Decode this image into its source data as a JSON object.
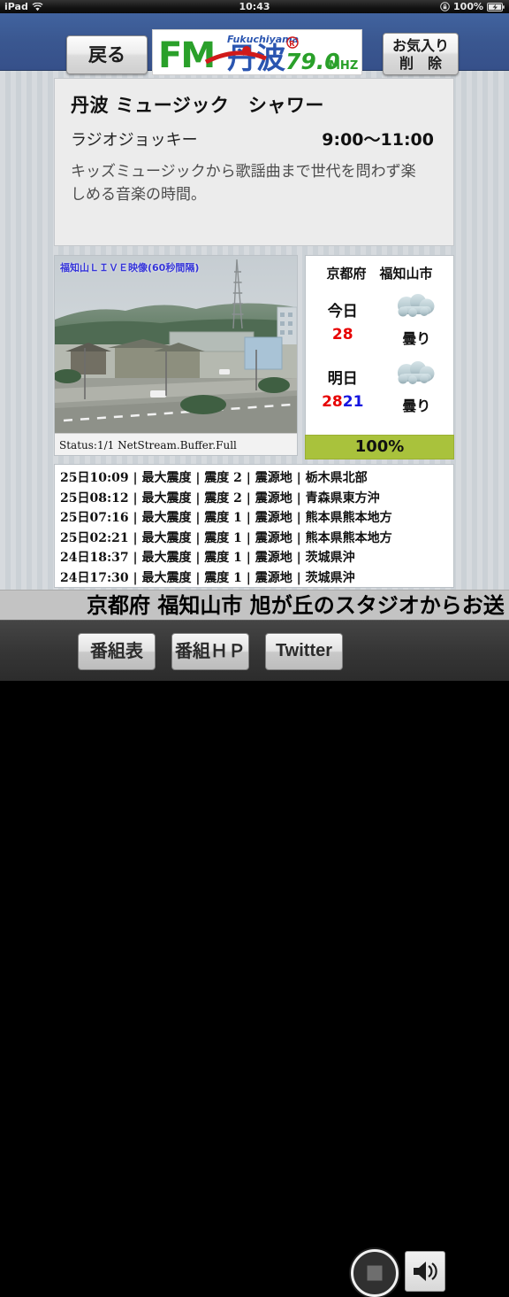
{
  "status_bar": {
    "device": "iPad",
    "wifi_icon": "wifi-icon",
    "time": "10:43",
    "rotation_lock_icon": "rotation-lock-icon",
    "battery_percent": "100%",
    "battery_icon": "battery-charging-icon"
  },
  "header": {
    "back_label": "戻る",
    "favorite_delete_line1": "お気入り",
    "favorite_delete_line2": "削　除",
    "logo": {
      "fm_text": "FM",
      "station_text": "丹波",
      "romaji_text": "Fukuchiyama",
      "registered_mark": "®",
      "frequency": "79.0",
      "frequency_unit": "MHZ",
      "green": "#2aa02a",
      "blue": "#2a55b0",
      "red": "#d01a1a"
    }
  },
  "program": {
    "title": "丹波 ミュージック　シャワー",
    "dj": "ラジオジョッキー",
    "time": "9:00〜11:00",
    "description": "キッズミュージックから歌謡曲まで世代を問わず楽しめる音楽の時間。"
  },
  "camera": {
    "label": "福知山ＬＩＶＥ映像(60秒間隔)",
    "status": "Status:1/1  NetStream.Buffer.Full"
  },
  "weather": {
    "region": "京都府　福知山市",
    "accent_green": "#a9c23c",
    "high_color": "#e70000",
    "low_color": "#1414e0",
    "days": [
      {
        "name": "今日",
        "high": "28",
        "low": "",
        "condition": "曇り",
        "icon": "cloud-icon"
      },
      {
        "name": "明日",
        "high": "28",
        "low": "21",
        "condition": "曇り",
        "icon": "cloud-icon"
      }
    ],
    "buffer_percent": "100%"
  },
  "earthquakes": {
    "rows": [
      "25日10:09 | 最大震度 | 震度 2 | 震源地 | 栃木県北部",
      "25日08:12 | 最大震度 | 震度 2 | 震源地 | 青森県東方沖",
      "25日07:16 | 最大震度 | 震度 1 | 震源地 | 熊本県熊本地方",
      "25日02:21 | 最大震度 | 震度 1 | 震源地 | 熊本県熊本地方",
      "24日18:37 | 最大震度 | 震度 1 | 震源地 | 茨城県沖",
      "24日17:30 | 最大震度 | 震度 1 | 震源地 | 茨城県沖"
    ]
  },
  "ticker": {
    "text": "京都府 福知山市 旭が丘のスタジオからお送"
  },
  "toolbar": {
    "schedule_label": "番組表",
    "homepage_label": "番組ＨＰ",
    "twitter_label": "Twitter",
    "stop_icon": "stop-icon",
    "speaker_icon": "speaker-icon"
  }
}
